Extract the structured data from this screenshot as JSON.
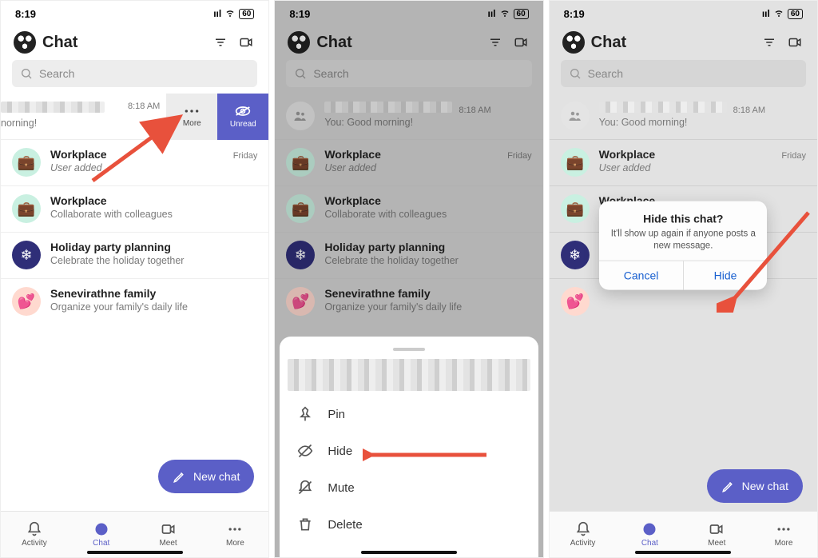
{
  "status": {
    "time": "8:19",
    "battery": "60"
  },
  "header": {
    "title": "Chat"
  },
  "search": {
    "placeholder": "Search"
  },
  "swipe": {
    "more": "More",
    "unread": "Unread"
  },
  "fab": {
    "label": "New chat"
  },
  "tabs": {
    "activity": "Activity",
    "chat": "Chat",
    "meet": "Meet",
    "more": "More"
  },
  "rows": {
    "r0": {
      "time": "8:18 AM",
      "sub_short": "norning!",
      "sub_full": "You: Good morning!"
    },
    "r1": {
      "title": "Workplace",
      "sub": "User added",
      "time": "Friday"
    },
    "r2": {
      "title": "Workplace",
      "sub": "Collaborate with colleagues"
    },
    "r3": {
      "title": "Holiday party planning",
      "sub": "Celebrate the holiday together"
    },
    "r4": {
      "title": "Senevirathne family",
      "sub": "Organize your family's daily life"
    }
  },
  "sheet": {
    "pin": "Pin",
    "hide": "Hide",
    "mute": "Mute",
    "delete": "Delete"
  },
  "alert": {
    "title": "Hide this chat?",
    "msg": "It'll show up again if anyone posts a new message.",
    "cancel": "Cancel",
    "hide": "Hide"
  }
}
